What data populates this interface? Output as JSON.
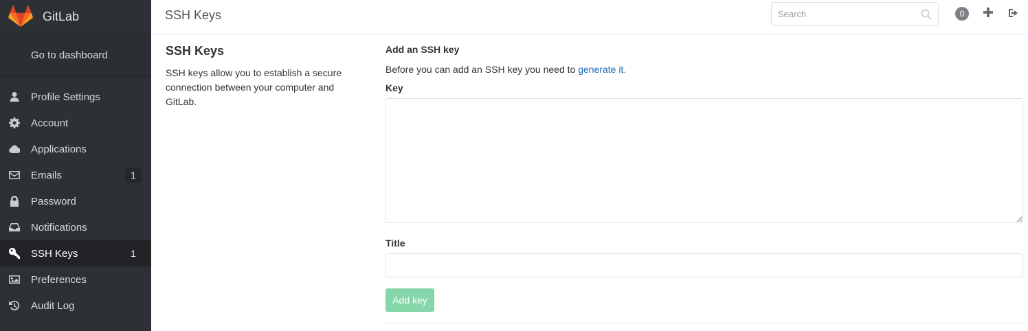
{
  "app": {
    "name": "GitLab"
  },
  "sidebar": {
    "dashboard_label": "Go to dashboard",
    "items": [
      {
        "label": "Profile Settings",
        "icon": "user-icon"
      },
      {
        "label": "Account",
        "icon": "gear-icon"
      },
      {
        "label": "Applications",
        "icon": "cloud-icon"
      },
      {
        "label": "Emails",
        "icon": "envelope-icon",
        "badge": "1"
      },
      {
        "label": "Password",
        "icon": "lock-icon"
      },
      {
        "label": "Notifications",
        "icon": "inbox-icon"
      },
      {
        "label": "SSH Keys",
        "icon": "key-icon",
        "badge": "1",
        "active": true
      },
      {
        "label": "Preferences",
        "icon": "image-icon"
      },
      {
        "label": "Audit Log",
        "icon": "history-icon"
      }
    ]
  },
  "header": {
    "title": "SSH Keys",
    "search_placeholder": "Search",
    "todo_count": "0"
  },
  "info": {
    "heading": "SSH Keys",
    "description": "SSH keys allow you to establish a secure connection between your computer and GitLab."
  },
  "form": {
    "heading": "Add an SSH key",
    "hint_prefix": "Before you can add an SSH key you need to ",
    "hint_link": "generate it.",
    "key_label": "Key",
    "key_value": "",
    "title_label": "Title",
    "title_value": "",
    "submit_label": "Add key"
  },
  "colors": {
    "sidebar_bg": "#2d3035",
    "link": "#1b69b6",
    "submit_bg": "#85d7a9",
    "logo_orange": "#e24329"
  }
}
